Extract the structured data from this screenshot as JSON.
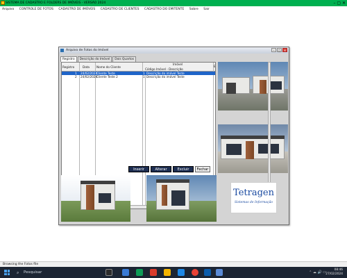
{
  "app": {
    "title": "SISTEMA DE CADASTRO E FOLDERS DE IMÓVEIS - VERSÃO 2024",
    "controls": "–  ▢  ✕"
  },
  "menu": [
    "Arquivo",
    "CONTROLE DE FOTOS",
    "CADASTRO DE IMÓVEIS",
    "CADASTRO DE CLIENTES",
    "CADASTRO DO EMITENTE",
    "Sobre",
    "Sair"
  ],
  "window": {
    "title": "Arquivo de Fotos do Imóvel",
    "ctrl_min": "–",
    "ctrl_max": "▢",
    "ctrl_close": "✕",
    "tabs": [
      "Registro",
      "Descrição do Imóvel",
      "Dois Quartos"
    ]
  },
  "grid": {
    "headers": {
      "registro": "Registro",
      "data": "Data",
      "cliente": "Nome do Cliente",
      "imovel": "Imóvel",
      "imovel_sub": "Código  Imóvel - Descrição",
      "extra": "E"
    },
    "rows": [
      {
        "registro": "1",
        "data": "24/02/2024",
        "cliente": "Cliente Teste",
        "codigo": "1",
        "descricao": "Descrição do imóvel Teste",
        "selected": true
      },
      {
        "registro": "2",
        "data": "24/02/2024",
        "cliente": "Cliente Teste 2",
        "codigo": "1",
        "descricao": "Descrição do imóvel Teste",
        "selected": false
      }
    ]
  },
  "buttons": {
    "inserir": "Inserir",
    "alterar": "Alterar",
    "excluir": "Excluir",
    "fechar": "Fechar"
  },
  "logo": {
    "name": "Tetragen",
    "subtitle": "Sistemas de Informação"
  },
  "statusbar": {
    "text": "Browsing the Fotos file"
  },
  "taskbar": {
    "search_placeholder": "Pesquisar",
    "time": "08:46",
    "date": "27/02/2024",
    "tray": "⌃  ☁  🔊  ▭"
  }
}
